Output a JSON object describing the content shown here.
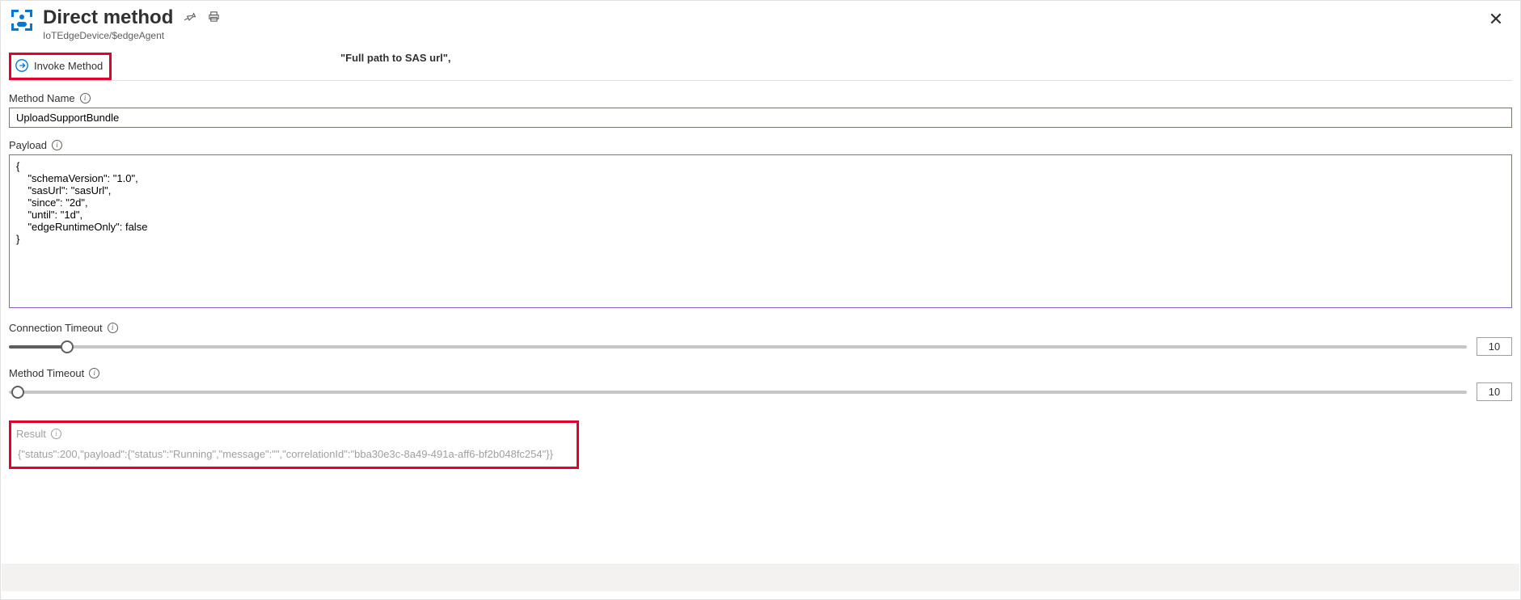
{
  "header": {
    "title": "Direct method",
    "breadcrumb": "IoTEdgeDevice/$edgeAgent"
  },
  "annotation": "\"Full path to SAS url\",",
  "toolbar": {
    "invoke_label": "Invoke Method"
  },
  "fields": {
    "method_name": {
      "label": "Method Name",
      "value": "UploadSupportBundle"
    },
    "payload": {
      "label": "Payload",
      "value": "{\n    \"schemaVersion\": \"1.0\",\n    \"sasUrl\": \"sasUrl\",\n    \"since\": \"2d\",\n    \"until\": \"1d\",\n    \"edgeRuntimeOnly\": false\n}"
    },
    "connection_timeout": {
      "label": "Connection Timeout",
      "value": "10"
    },
    "method_timeout": {
      "label": "Method Timeout",
      "value": "10"
    }
  },
  "result": {
    "label": "Result",
    "value": "{\"status\":200,\"payload\":{\"status\":\"Running\",\"message\":\"\",\"correlationId\":\"bba30e3c-8a49-491a-aff6-bf2b048fc254\"}}"
  }
}
